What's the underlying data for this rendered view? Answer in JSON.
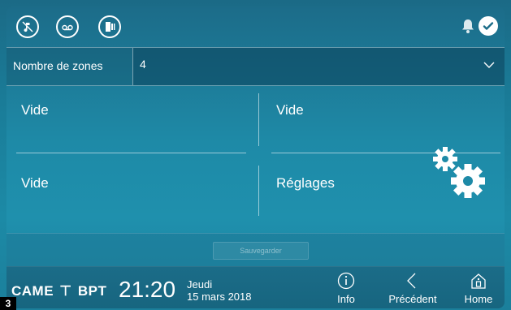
{
  "topbar": {
    "icons": [
      "music-muted-icon",
      "voicemail-icon",
      "door-icon"
    ],
    "right_icons": [
      "bell-icon",
      "check-icon"
    ]
  },
  "zones": {
    "label": "Nombre de zones",
    "value": "4"
  },
  "tiles": [
    {
      "label": "Vide"
    },
    {
      "label": "Vide"
    },
    {
      "label": "Vide"
    },
    {
      "label": "Réglages"
    }
  ],
  "save": {
    "label": "Sauvegarder"
  },
  "footer": {
    "brand_came": "CAME",
    "brand_bpt": "BPT",
    "time": "21:20",
    "day": "Jeudi",
    "date": "15 mars 2018",
    "nav": [
      {
        "label": "Info"
      },
      {
        "label": "Précédent"
      },
      {
        "label": "Home"
      }
    ]
  },
  "badge": "3",
  "colors": {
    "background": "#1c8aa6",
    "bar": "#17657f",
    "text": "#ffffff"
  }
}
